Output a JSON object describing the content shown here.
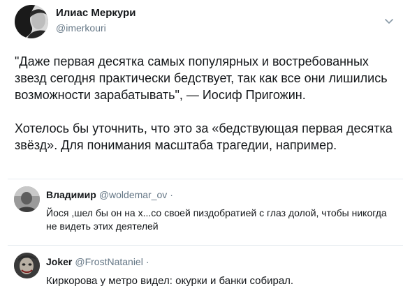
{
  "tweet": {
    "author_name": "Илиас Меркури",
    "author_handle": "@imerkouri",
    "text_paragraphs": [
      "\"Даже первая десятка самых популярных и востребованных звезд сегодня практически бедствует, так как все они лишились возможности зарабатывать\", — Иосиф Пригожин.",
      "Хотелось бы уточнить, что это за «бедствующая первая десятка звёзд». Для понимания масштаба трагедии, например."
    ],
    "menu_icon": "chevron-down-icon"
  },
  "replies": [
    {
      "name": "Владимир",
      "handle": "@woldemar_ov",
      "separator": "·",
      "text": "Йося ,шел бы он на х...со своей пиздобратией с глаз долой, чтобы никогда не видеть этих деятелей"
    },
    {
      "name": "Joker",
      "handle": "@FrostNataniel",
      "separator": "·",
      "text": "Киркорова у метро видел: окурки и банки собирал."
    }
  ],
  "colors": {
    "text": "#14171a",
    "secondary": "#657786",
    "divider": "#e6ecf0",
    "background": "#ffffff"
  }
}
